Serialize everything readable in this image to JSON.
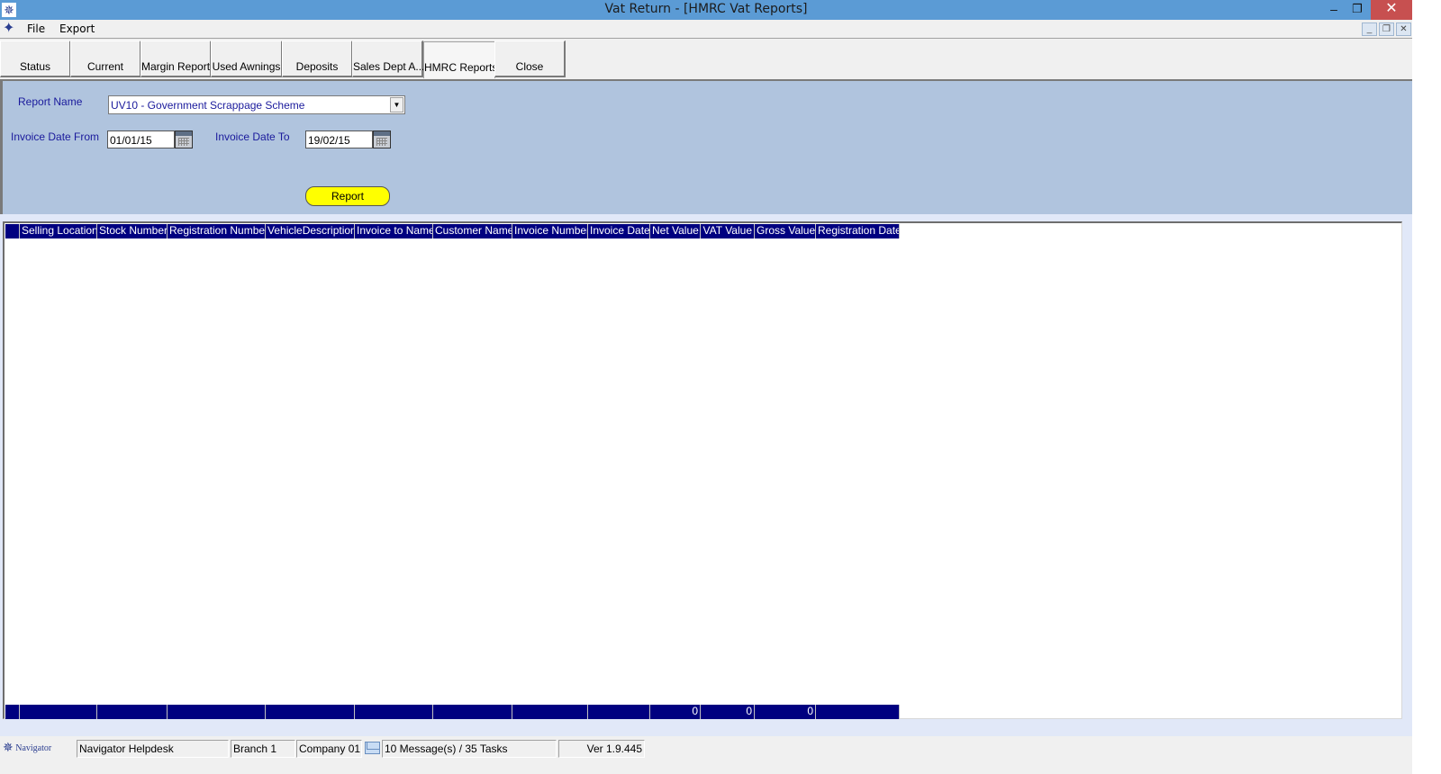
{
  "window": {
    "title": "Vat Return - [HMRC Vat Reports]",
    "app_icon": "navigator-compass-icon",
    "controls": {
      "minimize": "–",
      "maximize": "❐",
      "close": "✕"
    }
  },
  "menubar": {
    "items": [
      "File",
      "Export"
    ],
    "mdi_controls": {
      "minimize": "_",
      "restore": "❐",
      "close": "✕"
    }
  },
  "tabs": [
    {
      "label": "Status",
      "active": false
    },
    {
      "label": "Current",
      "active": false
    },
    {
      "label": "Margin Report",
      "active": false
    },
    {
      "label": "Used Awnings",
      "active": false
    },
    {
      "label": "Deposits",
      "active": false
    },
    {
      "label": "Sales Dept A...",
      "active": false
    },
    {
      "label": "HMRC Reports",
      "active": true
    },
    {
      "label": "Close",
      "active": false
    }
  ],
  "filters": {
    "report_name_label": "Report Name",
    "report_name_value": "UV10 - Government Scrappage Scheme",
    "date_from_label": "Invoice Date From",
    "date_from_value": "01/01/15",
    "date_to_label": "Invoice Date To",
    "date_to_value": "19/02/15",
    "report_button": "Report"
  },
  "grid": {
    "columns": [
      "",
      "Selling Location",
      "Stock Number",
      "Registration Number",
      "VehicleDescription",
      "Invoice to Name",
      "Customer Name",
      "Invoice Number",
      "Invoice Date",
      "Net Value",
      "VAT Value",
      "Gross Value",
      "Registration Date"
    ],
    "rows": [],
    "totals": [
      "",
      "",
      "",
      "",
      "",
      "",
      "",
      "",
      "",
      "0",
      "0",
      "0",
      ""
    ]
  },
  "statusbar": {
    "logo_text": "Navigator",
    "helpdesk": "Navigator Helpdesk",
    "branch": "Branch 1",
    "company": "Company 01",
    "messages": "10 Message(s) / 35 Tasks",
    "version": "Ver 1.9.445"
  },
  "colors": {
    "titlebar": "#5b9bd5",
    "close_button": "#c75050",
    "filter_panel": "#b0c4de",
    "grid_header": "#000080",
    "report_button": "#ffff00",
    "label_text": "#1a1a9c"
  }
}
